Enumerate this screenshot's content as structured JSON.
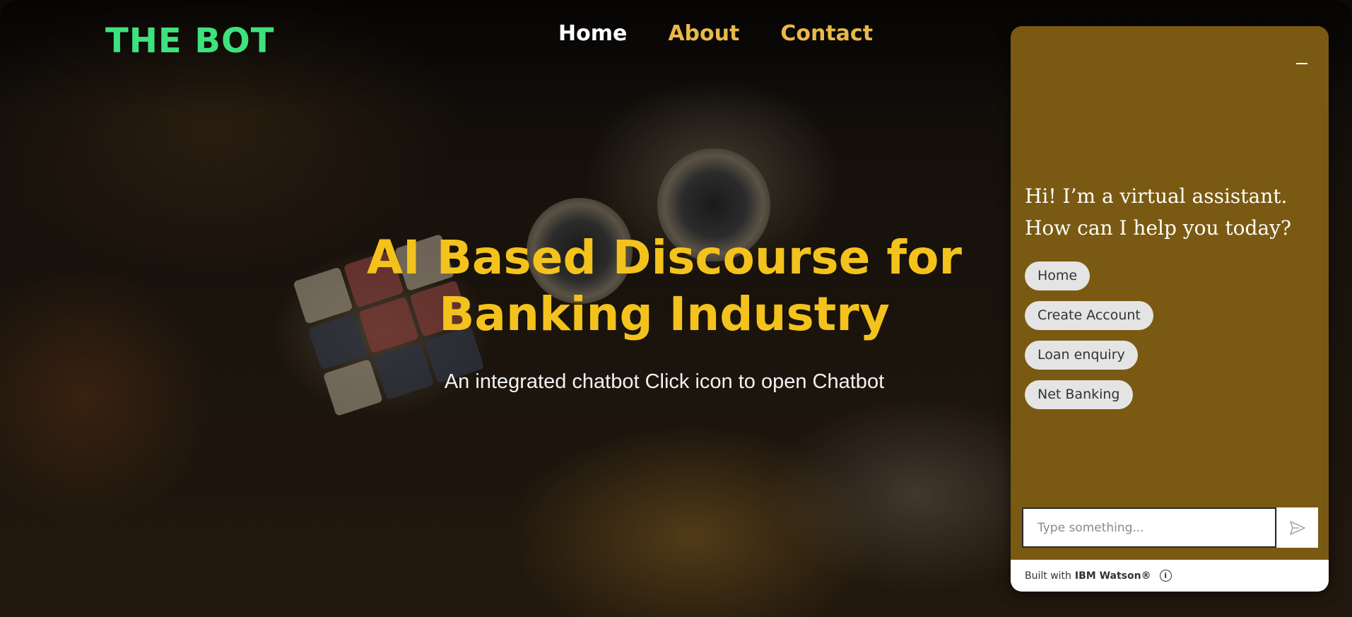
{
  "header": {
    "logo": "THE BOT",
    "nav": [
      {
        "label": "Home",
        "active": true
      },
      {
        "label": "About",
        "active": false
      },
      {
        "label": "Contact",
        "active": false
      }
    ]
  },
  "hero": {
    "title_line1": "AI Based Discourse for",
    "title_line2": "Banking Industry",
    "subtitle": "An integrated chatbot Click icon to open Chatbot"
  },
  "chatbot": {
    "greeting": "Hi! I’m a virtual assistant. How can I help you today?",
    "options": [
      "Home",
      "Create Account",
      "Loan enquiry",
      "Net Banking"
    ],
    "input_placeholder": "Type something...",
    "footer_prefix": "Built with",
    "footer_brand": "IBM Watson®"
  },
  "colors": {
    "logo": "#3ee27c",
    "nav_inactive": "#e8b84a",
    "hero_title": "#f4c21d",
    "chat_panel": "#7a5a12"
  },
  "icons": {
    "minimize": "minimize-icon",
    "send": "send-icon",
    "info": "info-icon"
  }
}
